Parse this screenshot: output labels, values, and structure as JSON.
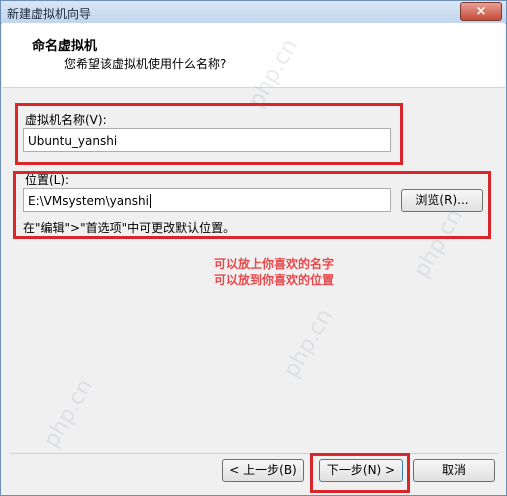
{
  "window": {
    "title": "新建虚拟机向导",
    "close_glyph": "×"
  },
  "header": {
    "title": "命名虚拟机",
    "subtitle": "您希望该虚拟机使用什么名称?"
  },
  "vm_name": {
    "label": "虚拟机名称(V):",
    "value": "Ubuntu_yanshi"
  },
  "location": {
    "label": "位置(L):",
    "value": "E:\\VMsystem\\yanshi",
    "browse_label": "浏览(R)...",
    "hint": "在\"编辑\">\"首选项\"中可更改默认位置。"
  },
  "annotation": {
    "line1": "可以放上你喜欢的名字",
    "line2": "可以放到你喜欢的位置"
  },
  "footer": {
    "back_label": "< 上一步(B)",
    "next_label": "下一步(N) >",
    "cancel_label": "取消"
  },
  "watermark": {
    "text": "php.cn"
  },
  "colors": {
    "highlight": "#d9262b",
    "annotation": "#e8484b"
  }
}
